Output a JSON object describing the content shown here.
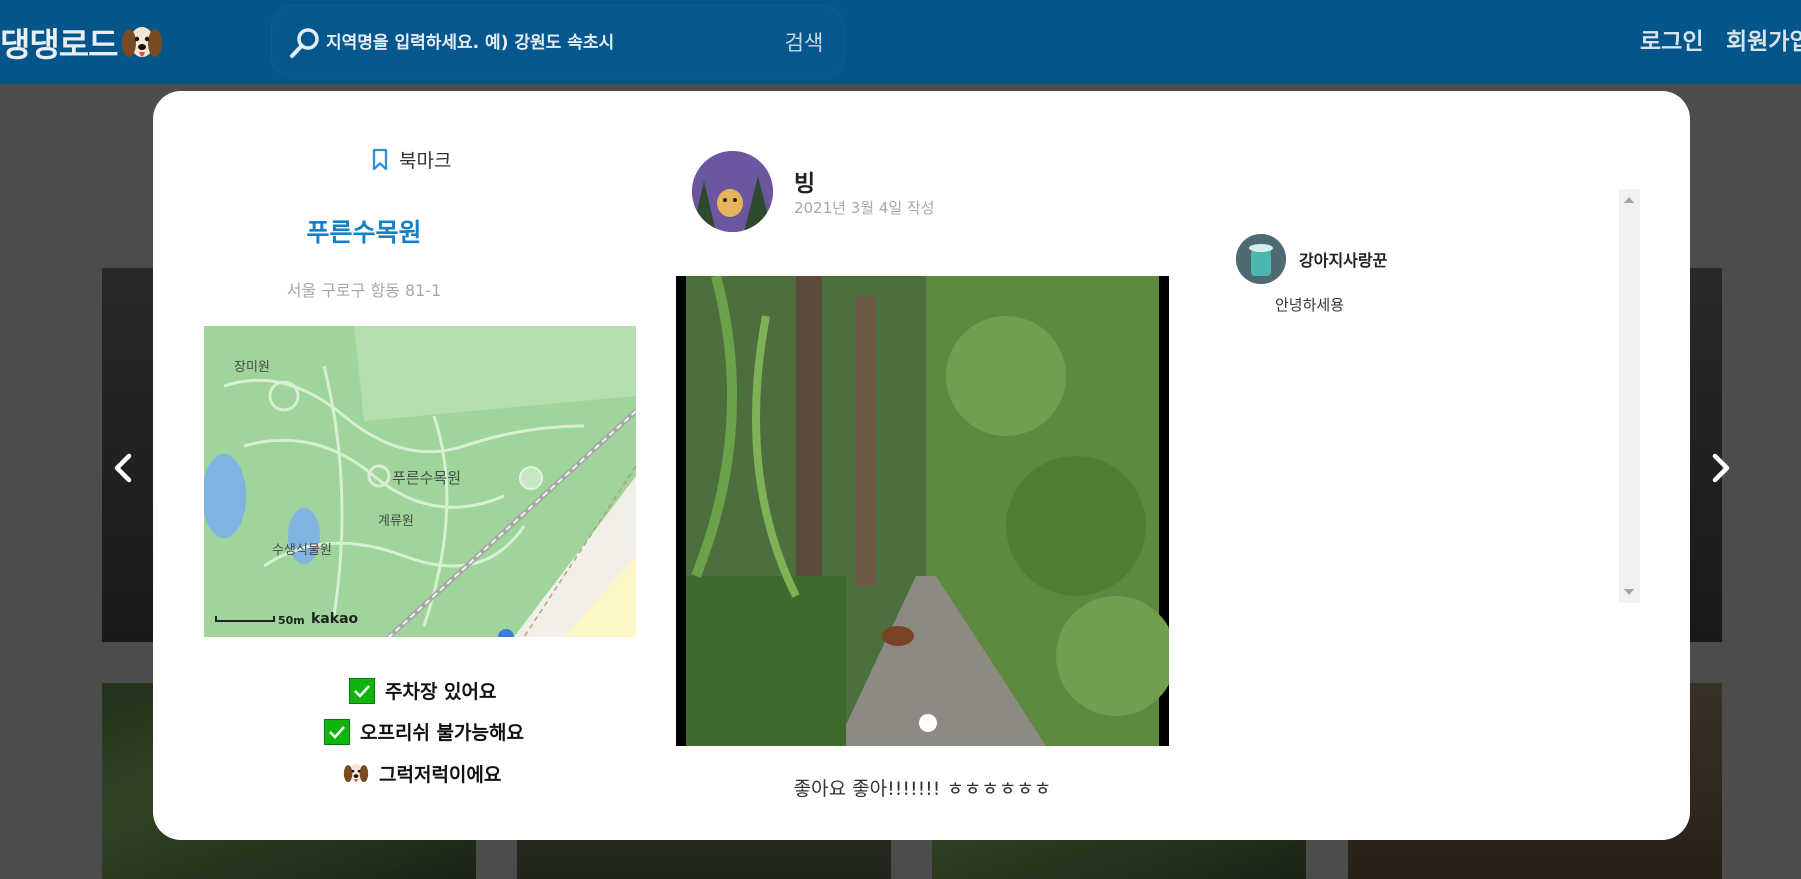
{
  "header": {
    "logo_text": "댕댕로드",
    "search_placeholder": "지역명을 입력하세요. 예) 강원도 속초시",
    "search_button": "검색",
    "login": "로그인",
    "signup": "회원가입"
  },
  "place": {
    "bookmark_label": "북마크",
    "name": "푸른수목원",
    "address": "서울 구로구 항동 81-1",
    "map": {
      "labels": [
        "장미원",
        "푸른수목원",
        "계류원",
        "수생식물원"
      ],
      "scale": "50m",
      "brand": "kakao"
    },
    "features": [
      {
        "icon": "check-icon",
        "text": "주차장 있어요"
      },
      {
        "icon": "check-icon",
        "text": "오프리쉬 불가능해요"
      },
      {
        "icon": "dog-icon",
        "text": "그럭저럭이에요"
      }
    ]
  },
  "post": {
    "author": "빙",
    "date": "2021년 3월 4일 작성",
    "caption": "좋아요 좋아!!!!!!! ㅎㅎㅎㅎㅎㅎ"
  },
  "comments": [
    {
      "user": "강아지사랑꾼",
      "text": "안녕하세용"
    }
  ],
  "colors": {
    "header": "#03558a",
    "place_name": "#1480c9",
    "check": "#0fb40f"
  }
}
